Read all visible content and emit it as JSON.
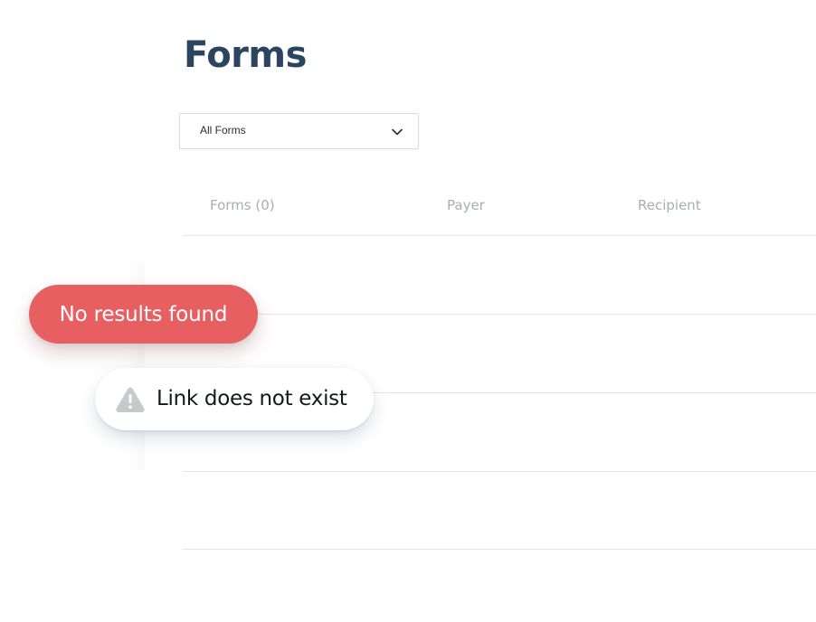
{
  "page": {
    "title": "Forms"
  },
  "filter": {
    "selected": "All Forms",
    "icon": "chevron-down-icon"
  },
  "table": {
    "columns": [
      "Forms (0)",
      "Payer",
      "Recipient"
    ],
    "rows": []
  },
  "toasts": {
    "error": {
      "text": "No results found",
      "color": "#e85f62"
    },
    "warning": {
      "text": "Link does not exist",
      "icon": "warning-icon",
      "icon_color": "#c7c9cc"
    }
  },
  "colors": {
    "title": "#2b4561",
    "header_text": "#a9adb3",
    "divider": "#e3e5e8"
  }
}
